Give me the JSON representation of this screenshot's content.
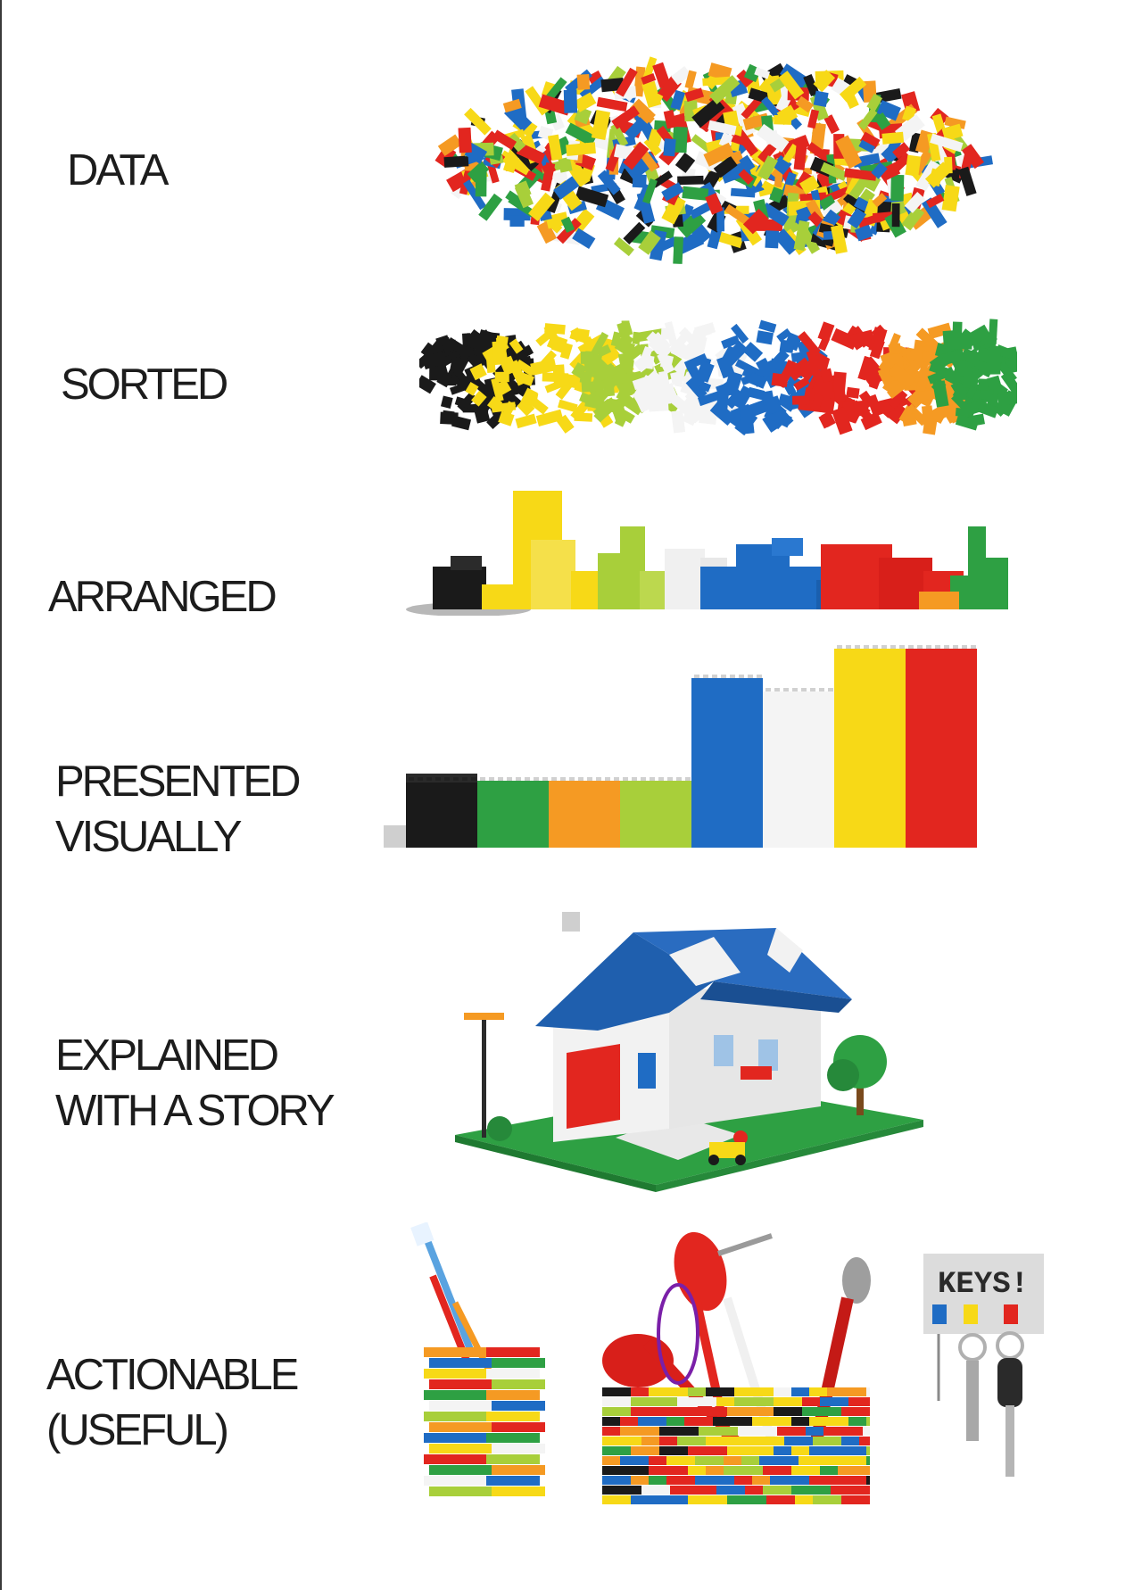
{
  "labels": {
    "data": "DATA",
    "sorted": "SORTED",
    "arranged": "ARRANGED",
    "presented_line1": "PRESENTED",
    "presented_line2": "VISUALLY",
    "explained_line1": "EXPLAINED",
    "explained_line2": "WITH A STORY",
    "actionable_line1": "ACTIONABLE",
    "actionable_line2": "(USEFUL)"
  },
  "keys_sign": "KEYS!",
  "colors": {
    "red": "#e2261f",
    "yellow": "#f7d917",
    "blue": "#1f6cc4",
    "green": "#2ea043",
    "lime": "#a8cf3a",
    "orange": "#f59a23",
    "black": "#1a1a1a",
    "white": "#f4f4f4"
  }
}
